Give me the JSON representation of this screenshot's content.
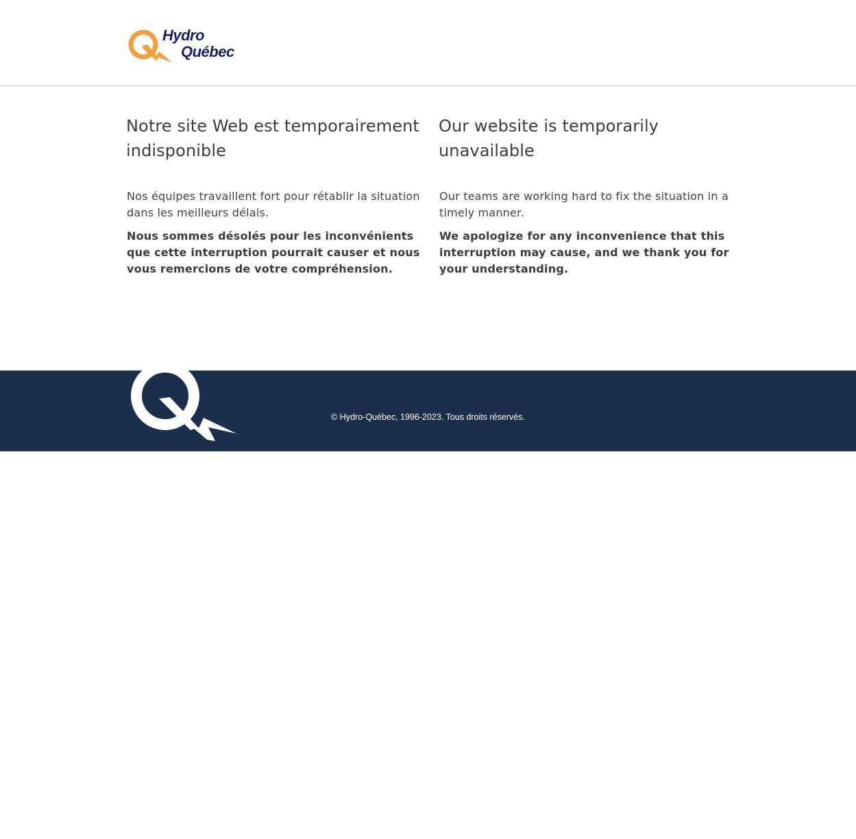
{
  "header": {
    "logo": {
      "icon": "hydro-quebec-q-icon",
      "line1": "Hydro",
      "line2": "Québec",
      "brand_color": "#1b1f6b",
      "accent_color": "#f0a03c"
    }
  },
  "main": {
    "french": {
      "title": "Notre site Web est temporairement indisponible",
      "paragraph": "Nos équipes travaillent fort pour rétablir la situation dans les meilleurs délais.",
      "apology": "Nous sommes désolés pour les inconvénients que cette interruption pourrait causer et nous vous remercions de votre compréhension."
    },
    "english": {
      "title": "Our website is temporarily unavailable",
      "paragraph": "Our teams are working hard to fix the situation in a timely manner.",
      "apology": "We apologize for any inconvenience that this interruption may cause, and we thank you for your understanding."
    }
  },
  "footer": {
    "icon": "hydro-quebec-q-icon",
    "copyright": "© Hydro-Québec, 1996-2023. Tous droits réservés.",
    "background_color": "#1a2f4b"
  }
}
